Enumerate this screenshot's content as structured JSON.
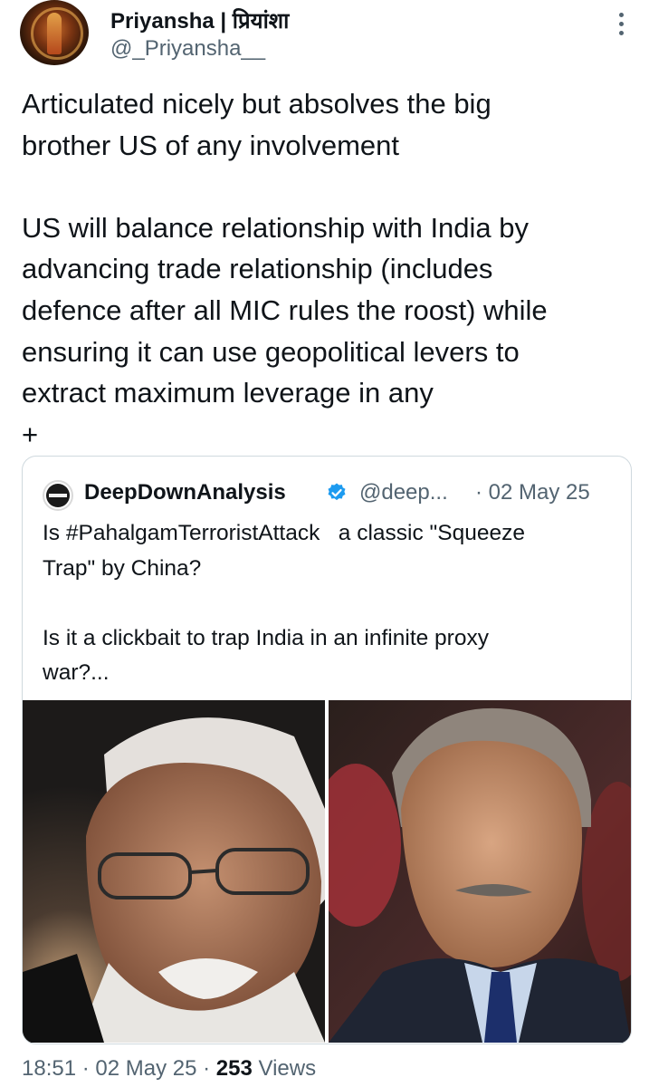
{
  "author": {
    "display_name": "Priyansha | प्रियांशा",
    "handle": "@_Priyansha__"
  },
  "tweet": {
    "text": "Articulated nicely but absolves the big\nbrother US of any involvement\n\nUS will balance relationship with India by\nadvancing trade relationship (includes\ndefence after all MIC rules the roost) while\nensuring it can use geopolitical levers to\nextract maximum leverage in any\n+"
  },
  "quoted": {
    "display_name": "DeepDownAnalysis",
    "handle": "@deep...",
    "date": "· 02 May 25",
    "avatar_text": "DEEP DOWN ANALYSIS",
    "text": "Is #PahalgamTerroristAttack   a classic \"Squeeze\nTrap\" by China?\n\nIs it a clickbait to trap India in an infinite proxy\nwar?...",
    "images": [
      "portrait-photo-left",
      "portrait-photo-right"
    ]
  },
  "meta": {
    "time": "18:51",
    "sep1": " · ",
    "date": "02 May 25",
    "sep2": " · ",
    "views_count": "253",
    "views_label": " Views"
  },
  "colors": {
    "text": "#0f1419",
    "secondary": "#536471",
    "border": "#cfd9de",
    "verified": "#1d9bf0"
  }
}
